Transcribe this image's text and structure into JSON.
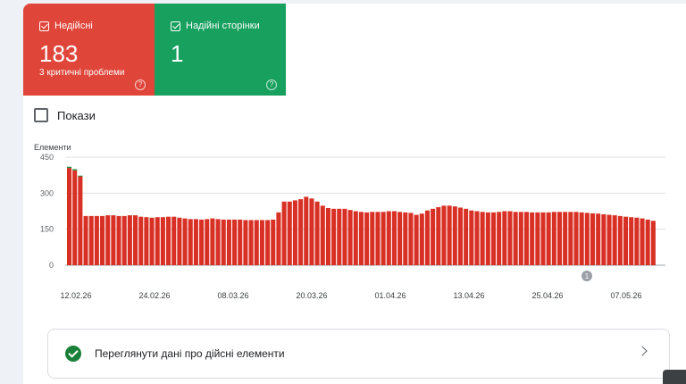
{
  "tiles": {
    "invalid": {
      "label": "Недійсні",
      "count": "183",
      "sub": "3 критичні проблеми",
      "checked": true,
      "color": "#e0453a"
    },
    "valid": {
      "label": "Надійні сторінки",
      "count": "1",
      "checked": true,
      "color": "#17a05e"
    }
  },
  "impressions_label": "Покази",
  "valid_link": "Переглянути дані про дійсні елементи",
  "chart_data": {
    "type": "bar",
    "ylabel": "Елементи",
    "ylim": [
      0,
      450
    ],
    "yticks": [
      0,
      150,
      300,
      450
    ],
    "xtick_labels": [
      "12.02.26",
      "24.02.26",
      "08.03.26",
      "20.03.26",
      "01.04.26",
      "13.04.26",
      "25.04.26",
      "07.05.26"
    ],
    "annotation": "1",
    "series": [
      {
        "color": "#d93025",
        "values": [
          405,
          395,
          370,
          205,
          205,
          205,
          205,
          208,
          208,
          205,
          205,
          208,
          208,
          202,
          200,
          198,
          200,
          200,
          202,
          202,
          198,
          195,
          192,
          192,
          190,
          192,
          195,
          192,
          190,
          190,
          190,
          190,
          188,
          188,
          188,
          188,
          188,
          190,
          220,
          265,
          265,
          270,
          275,
          285,
          278,
          265,
          248,
          238,
          235,
          235,
          235,
          230,
          225,
          222,
          220,
          222,
          222,
          222,
          225,
          225,
          222,
          220,
          218,
          210,
          215,
          228,
          235,
          242,
          248,
          248,
          245,
          240,
          235,
          228,
          225,
          222,
          220,
          220,
          222,
          225,
          225,
          222,
          222,
          222,
          220,
          220,
          220,
          220,
          222,
          222,
          222,
          222,
          222,
          220,
          218,
          216,
          215,
          212,
          210,
          208,
          205,
          202,
          200,
          198,
          195,
          190,
          185
        ]
      },
      {
        "color": "#1e8e3e",
        "values": [
          5,
          5,
          3,
          0,
          0,
          0,
          0,
          0,
          0,
          0,
          0,
          0,
          0,
          0,
          0,
          0,
          0,
          0,
          0,
          0,
          0,
          0,
          0,
          0,
          0,
          0,
          0,
          0,
          0,
          0,
          0,
          0,
          0,
          0,
          0,
          0,
          0,
          0,
          0,
          0,
          0,
          0,
          0,
          0,
          0,
          0,
          0,
          0,
          0,
          0,
          0,
          0,
          0,
          0,
          0,
          0,
          0,
          0,
          0,
          0,
          0,
          0,
          0,
          0,
          0,
          0,
          0,
          0,
          0,
          0,
          0,
          0,
          0,
          0,
          0,
          0,
          0,
          0,
          0,
          0,
          0,
          0,
          0,
          0,
          0,
          0,
          0,
          0,
          0,
          0,
          0,
          0,
          0,
          0,
          0,
          0,
          0,
          0,
          0,
          0,
          0,
          0,
          0,
          0,
          0,
          0,
          0
        ]
      }
    ]
  }
}
